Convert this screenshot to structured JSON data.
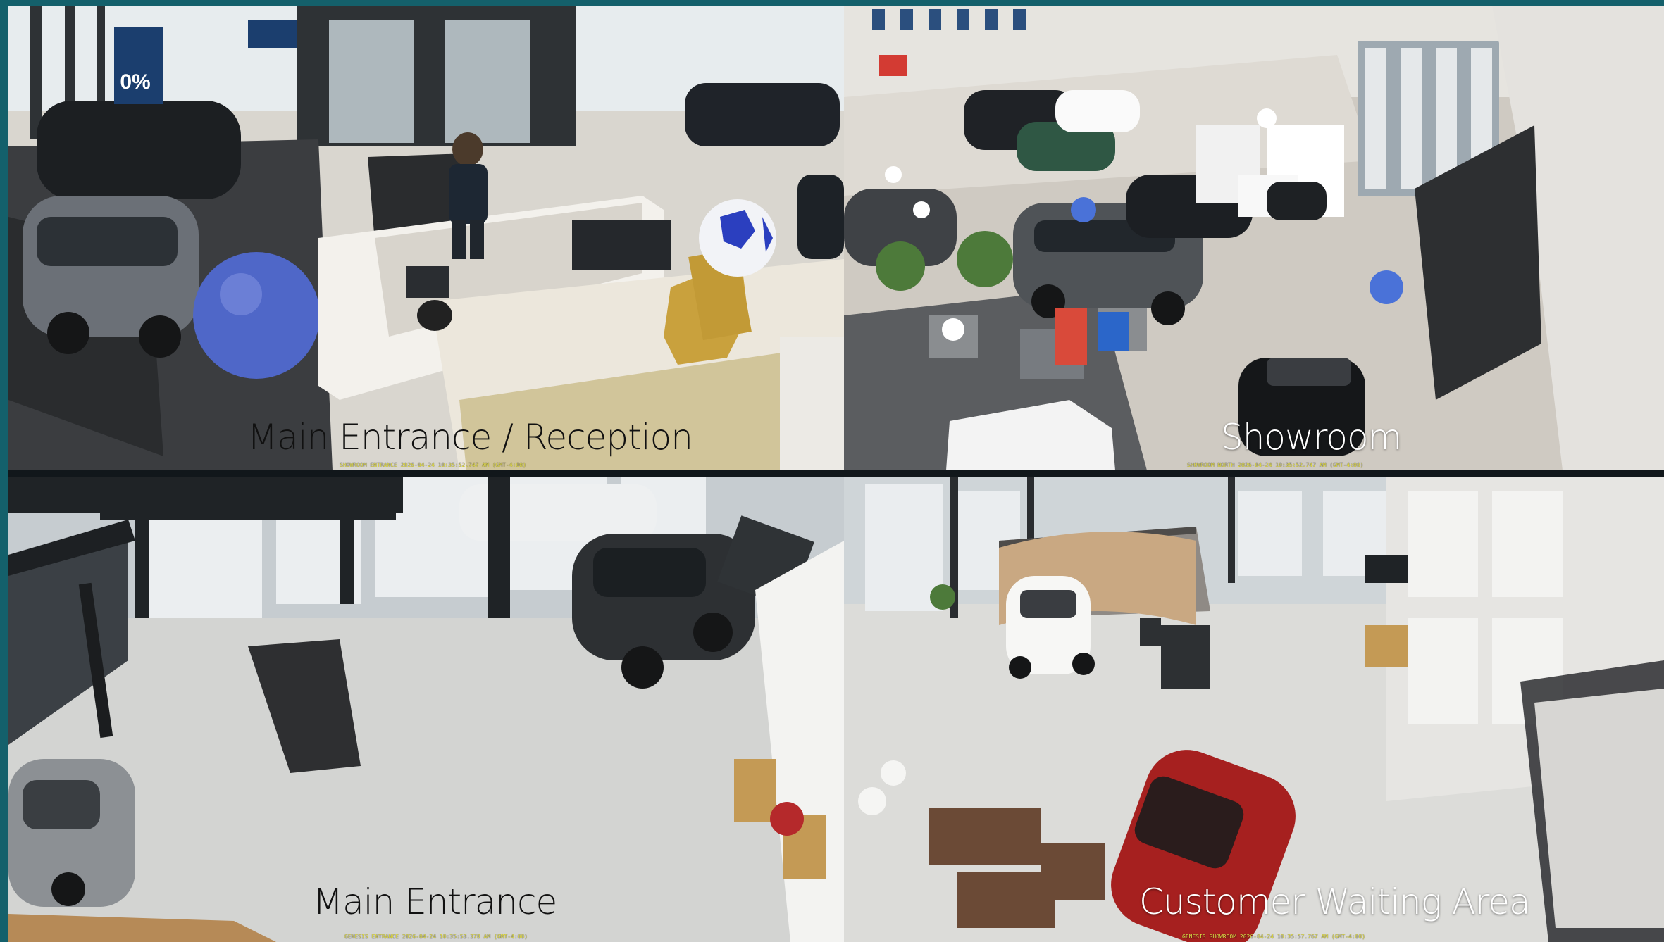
{
  "colors": {
    "border": "#14606b",
    "osd_text": "#e8e24a"
  },
  "cameras": [
    {
      "label": "Main Entrance / Reception",
      "osd": "SHOWROOM ENTRANCE 2026-04-24 10:35:52.747 AM (GMT-4:00)"
    },
    {
      "label": "Showroom",
      "osd": "SHOWROOM NORTH 2026-04-24 10:35:52.747 AM (GMT-4:00)"
    },
    {
      "label": "Main Entrance",
      "osd": "GENESIS ENTRANCE 2026-04-24 10:35:53.378 AM (GMT-4:00)"
    },
    {
      "label": "Customer Waiting Area",
      "osd": "GENESIS SHOWROOM 2026-04-24 10:35:57.767 AM (GMT-4:00)"
    }
  ],
  "signage": {
    "financing_rate": "0%"
  }
}
